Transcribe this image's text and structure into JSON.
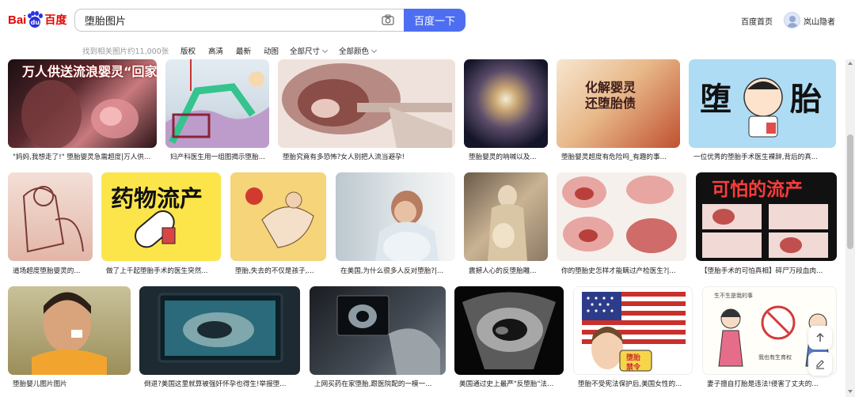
{
  "brand": {
    "logo_left": "Bai",
    "logo_paw": "du",
    "logo_right": "百度"
  },
  "search": {
    "query": "堕胎图片",
    "button_label": "百度一下",
    "camera_icon": "camera-icon"
  },
  "topbar": {
    "home_link": "百度首页",
    "username": "岚山隐者"
  },
  "filters": {
    "result_count": "找到相关图片约11,000张",
    "items": [
      "版权",
      "高清",
      "最新",
      "动图"
    ],
    "size_dropdown": "全部尺寸",
    "color_dropdown": "全部颜色"
  },
  "image_rows": [
    [
      {
        "caption": "\"妈妈,我想走了!\" 堕胎婴灵急需超度|万人供养...",
        "overlay": "万人供送流浪婴灵“回家”"
      },
      {
        "caption": "妇产科医生用一组图揭示堕胎..."
      },
      {
        "caption": "堕胎究竟有多恐怖?女人别把人流当避孕!"
      },
      {
        "caption": "堕胎婴灵的呐喊以及..."
      },
      {
        "caption": "堕胎婴灵超度有危险吗_有趣的事...",
        "overlay_line1": "化解婴灵",
        "overlay_line2": "还堕胎债"
      },
      {
        "caption": "一位优秀的堕胎手术医生裸辞,背后的真...",
        "overlay_left": "堕",
        "overlay_right": "胎"
      }
    ],
    [
      {
        "caption": "道场超度堕胎婴灵的..."
      },
      {
        "caption": "做了上千起堕胎手术的医生突然...",
        "overlay": "药物流产"
      },
      {
        "caption": "堕胎,失去的不仅是孩子,..."
      },
      {
        "caption": "在美国,为什么很多人反对堕胎?|..."
      },
      {
        "caption": "震撼人心的反堕胎雕..."
      },
      {
        "caption": "你的堕胎史怎样才能瞒过产检医生?|..."
      },
      {
        "caption": "【堕胎手术的可怕真相】碎尸万段血肉...",
        "overlay": "可怕的流产"
      }
    ],
    [
      {
        "caption": "堕胎婴儿图片图片"
      },
      {
        "caption": "倒退?美国这里就算被强奸怀孕也得生!举报堕..."
      },
      {
        "caption": "上网买药在家堕胎,跟医院配的一模一..."
      },
      {
        "caption": "美国通过史上最严\"反堕胎\"法..."
      },
      {
        "caption": "堕胎不受宪法保护后,美国女性的...",
        "badge_line1": "堕胎",
        "badge_line2": "禁令"
      },
      {
        "caption": "妻子擅自打胎是违法!侵害了丈夫的...",
        "overlay_line1": "生不生是我的事",
        "overlay_line2": "我也有生育权"
      }
    ]
  ],
  "colors": {
    "accent": "#4e6ef2",
    "brand_red": "#e10602",
    "brand_blue": "#2932e1"
  }
}
